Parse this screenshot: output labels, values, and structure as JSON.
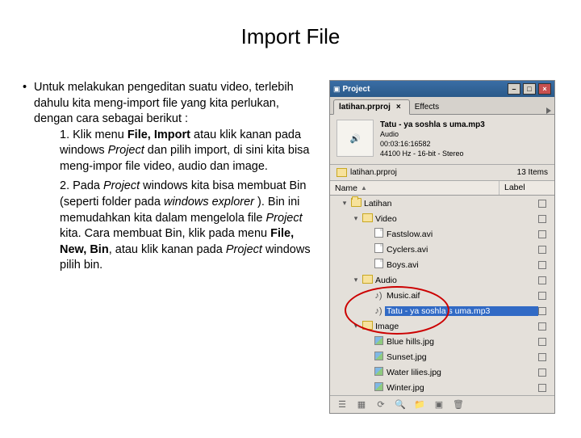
{
  "title": "Import File",
  "bullet_intro": "Untuk melakukan pengeditan suatu video, terlebih dahulu kita meng-import file yang kita perlukan, dengan cara sebagai berikut :",
  "step1_a": "1. Klik menu ",
  "step1_b": "File, Import",
  "step1_c": " atau klik kanan pada windows ",
  "step1_d": "Project",
  "step1_e": " dan pilih import, di sini kita bisa meng-impor file video, audio dan image.",
  "step2_a": "2. Pada ",
  "step2_b": "Project",
  "step2_c": " windows kita bisa membuat Bin (seperti folder pada ",
  "step2_d": "windows explorer",
  "step2_e": " ). Bin ini memudahkan kita dalam mengelola file ",
  "step2_f": "Project",
  "step2_g": " kita. Cara membuat Bin, klik pada menu ",
  "step2_h": "File, New, Bin",
  "step2_i": ", atau klik kanan pada ",
  "step2_j": "Project",
  "step2_k": " windows pilih bin.",
  "panel": {
    "window_title": "Project",
    "tabs": [
      "latihan.prproj",
      "Effects"
    ],
    "preview": {
      "name": "Tatu - ya soshla s uma.mp3",
      "type": "Audio",
      "rate": "00:03:16:16582",
      "fmt": "44100 Hz - 16-bit - Stereo"
    },
    "path": "latihan.prproj",
    "item_count": "13 Items",
    "cols": {
      "name": "Name",
      "label": "Label"
    },
    "tree": [
      {
        "lvl": 0,
        "icon": "folder",
        "name": "Latihan",
        "exp": "▾"
      },
      {
        "lvl": 1,
        "icon": "bin",
        "name": "Video",
        "exp": "▾"
      },
      {
        "lvl": 2,
        "icon": "file",
        "name": "Fastslow.avi"
      },
      {
        "lvl": 2,
        "icon": "file",
        "name": "Cyclers.avi"
      },
      {
        "lvl": 2,
        "icon": "file",
        "name": "Boys.avi"
      },
      {
        "lvl": 1,
        "icon": "bin",
        "name": "Audio",
        "exp": "▾"
      },
      {
        "lvl": 2,
        "icon": "audio",
        "name": "Music.aif"
      },
      {
        "lvl": 2,
        "icon": "audio",
        "name": "Tatu - ya soshla s uma.mp3",
        "selected": true
      },
      {
        "lvl": 1,
        "icon": "bin",
        "name": "Image",
        "exp": "▾"
      },
      {
        "lvl": 2,
        "icon": "img",
        "name": "Blue hills.jpg"
      },
      {
        "lvl": 2,
        "icon": "img",
        "name": "Sunset.jpg"
      },
      {
        "lvl": 2,
        "icon": "img",
        "name": "Water lilies.jpg"
      },
      {
        "lvl": 2,
        "icon": "img",
        "name": "Winter.jpg"
      }
    ]
  }
}
